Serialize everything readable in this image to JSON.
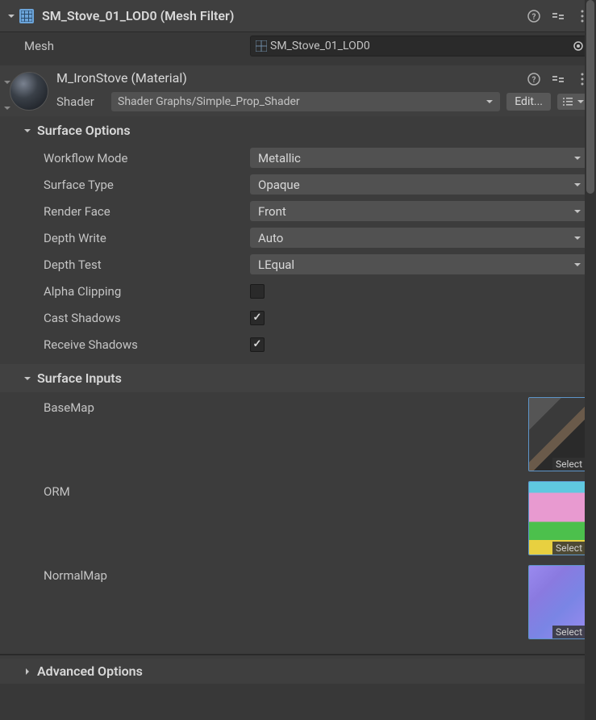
{
  "meshFilter": {
    "title": "SM_Stove_01_LOD0 (Mesh Filter)",
    "meshLabel": "Mesh",
    "meshValue": "SM_Stove_01_LOD0"
  },
  "material": {
    "title": "M_IronStove (Material)",
    "shaderLabel": "Shader",
    "shaderValue": "Shader Graphs/Simple_Prop_Shader",
    "editLabel": "Edit..."
  },
  "surfaceOptions": {
    "title": "Surface Options",
    "workflowMode": {
      "label": "Workflow Mode",
      "value": "Metallic"
    },
    "surfaceType": {
      "label": "Surface Type",
      "value": "Opaque"
    },
    "renderFace": {
      "label": "Render Face",
      "value": "Front"
    },
    "depthWrite": {
      "label": "Depth Write",
      "value": "Auto"
    },
    "depthTest": {
      "label": "Depth Test",
      "value": "LEqual"
    },
    "alphaClipping": {
      "label": "Alpha Clipping",
      "checked": false
    },
    "castShadows": {
      "label": "Cast Shadows",
      "checked": true
    },
    "receiveShadows": {
      "label": "Receive Shadows",
      "checked": true
    }
  },
  "surfaceInputs": {
    "title": "Surface Inputs",
    "baseMap": {
      "label": "BaseMap",
      "select": "Select"
    },
    "orm": {
      "label": "ORM",
      "select": "Select"
    },
    "normalMap": {
      "label": "NormalMap",
      "select": "Select"
    }
  },
  "advancedOptions": {
    "title": "Advanced Options"
  }
}
